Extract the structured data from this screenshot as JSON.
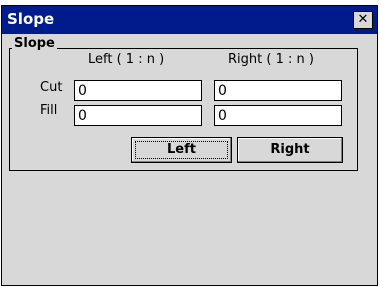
{
  "window": {
    "title": "Slope",
    "close_glyph": "✕"
  },
  "group": {
    "legend": "Slope",
    "columns": {
      "left": "Left ( 1 : n )",
      "right": "Right ( 1 : n )"
    },
    "rows": {
      "cut_label": "Cut",
      "fill_label": "Fill"
    },
    "values": {
      "cut_left": "0",
      "cut_right": "0",
      "fill_left": "0",
      "fill_right": "0"
    }
  },
  "buttons": {
    "left_label": "Left",
    "right_label": "Right"
  },
  "colors": {
    "titlebar": "#001c8c",
    "face": "#d8d8d8"
  }
}
